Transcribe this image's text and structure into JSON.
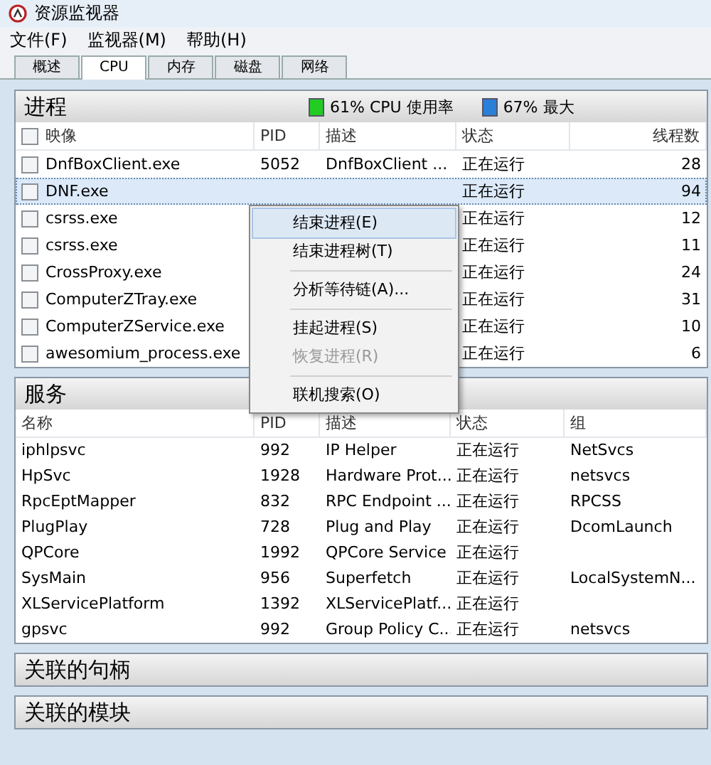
{
  "window": {
    "title": "资源监视器"
  },
  "menu_bar": [
    "文件(F)",
    "监视器(M)",
    "帮助(H)"
  ],
  "tabs": [
    {
      "label": "概述",
      "selected": false
    },
    {
      "label": "CPU",
      "selected": true
    },
    {
      "label": "内存",
      "selected": false
    },
    {
      "label": "磁盘",
      "selected": false
    },
    {
      "label": "网络",
      "selected": false
    }
  ],
  "processes": {
    "title": "进程",
    "meters": [
      {
        "text": "61% CPU 使用率",
        "color": "#22cc22"
      },
      {
        "text": "67% 最大",
        "color": "#2a7fd8"
      }
    ],
    "columns": [
      "映像",
      "PID",
      "描述",
      "状态",
      "线程数"
    ],
    "all_checked": false,
    "rows": [
      {
        "image": "DnfBoxClient.exe",
        "pid": "5052",
        "description": "DnfBoxClient ...",
        "status": "正在运行",
        "threads": "28",
        "checked": false,
        "selected": false
      },
      {
        "image": "DNF.exe",
        "status": "正在运行",
        "threads": "94",
        "checked": false,
        "selected": true
      },
      {
        "image": "csrss.exe",
        "status": "正在运行",
        "threads": "12",
        "checked": false,
        "selected": false
      },
      {
        "image": "csrss.exe",
        "status": "正在运行",
        "threads": "11",
        "checked": false,
        "selected": false
      },
      {
        "image": "CrossProxy.exe",
        "status": "正在运行",
        "threads": "24",
        "checked": false,
        "selected": false
      },
      {
        "image": "ComputerZTray.exe",
        "status": "正在运行",
        "threads": "31",
        "checked": false,
        "selected": false
      },
      {
        "image": "ComputerZService.exe",
        "status": "正在运行",
        "threads": "10",
        "checked": false,
        "selected": false
      },
      {
        "image": "awesomium_process.exe",
        "status": "正在运行",
        "threads": "6",
        "checked": false,
        "selected": false
      }
    ]
  },
  "context_menu": [
    {
      "kind": "item",
      "label": "结束进程(E)",
      "selected": true,
      "disabled": false
    },
    {
      "kind": "item",
      "label": "结束进程树(T)",
      "selected": false,
      "disabled": false
    },
    {
      "kind": "separator"
    },
    {
      "kind": "item",
      "label": "分析等待链(A)...",
      "selected": false,
      "disabled": false
    },
    {
      "kind": "separator"
    },
    {
      "kind": "item",
      "label": "挂起进程(S)",
      "selected": false,
      "disabled": false
    },
    {
      "kind": "item",
      "label": "恢复进程(R)",
      "selected": false,
      "disabled": true
    },
    {
      "kind": "separator"
    },
    {
      "kind": "item",
      "label": "联机搜索(O)",
      "selected": false,
      "disabled": false
    }
  ],
  "services": {
    "title": "服务",
    "columns": [
      "名称",
      "PID",
      "描述",
      "状态",
      "组"
    ],
    "rows": [
      {
        "name": "iphlpsvc",
        "pid": "992",
        "description": "IP Helper",
        "status": "正在运行",
        "group": "NetSvcs"
      },
      {
        "name": "HpSvc",
        "pid": "1928",
        "description": "Hardware Prot...",
        "status": "正在运行",
        "group": "netsvcs"
      },
      {
        "name": "RpcEptMapper",
        "pid": "832",
        "description": "RPC Endpoint ...",
        "status": "正在运行",
        "group": "RPCSS"
      },
      {
        "name": "PlugPlay",
        "pid": "728",
        "description": "Plug and Play",
        "status": "正在运行",
        "group": "DcomLaunch"
      },
      {
        "name": "QPCore",
        "pid": "1992",
        "description": "QPCore Service",
        "status": "正在运行"
      },
      {
        "name": "SysMain",
        "pid": "956",
        "description": "Superfetch",
        "status": "正在运行",
        "group": "LocalSystemN..."
      },
      {
        "name": "XLServicePlatform",
        "pid": "1392",
        "description": "XLServicePlatf...",
        "status": "正在运行"
      },
      {
        "name": "gpsvc",
        "pid": "992",
        "description": "Group Policy C...",
        "status": "正在运行",
        "group": "netsvcs"
      }
    ]
  },
  "collapsed_sections": [
    "关联的句柄",
    "关联的模块"
  ]
}
